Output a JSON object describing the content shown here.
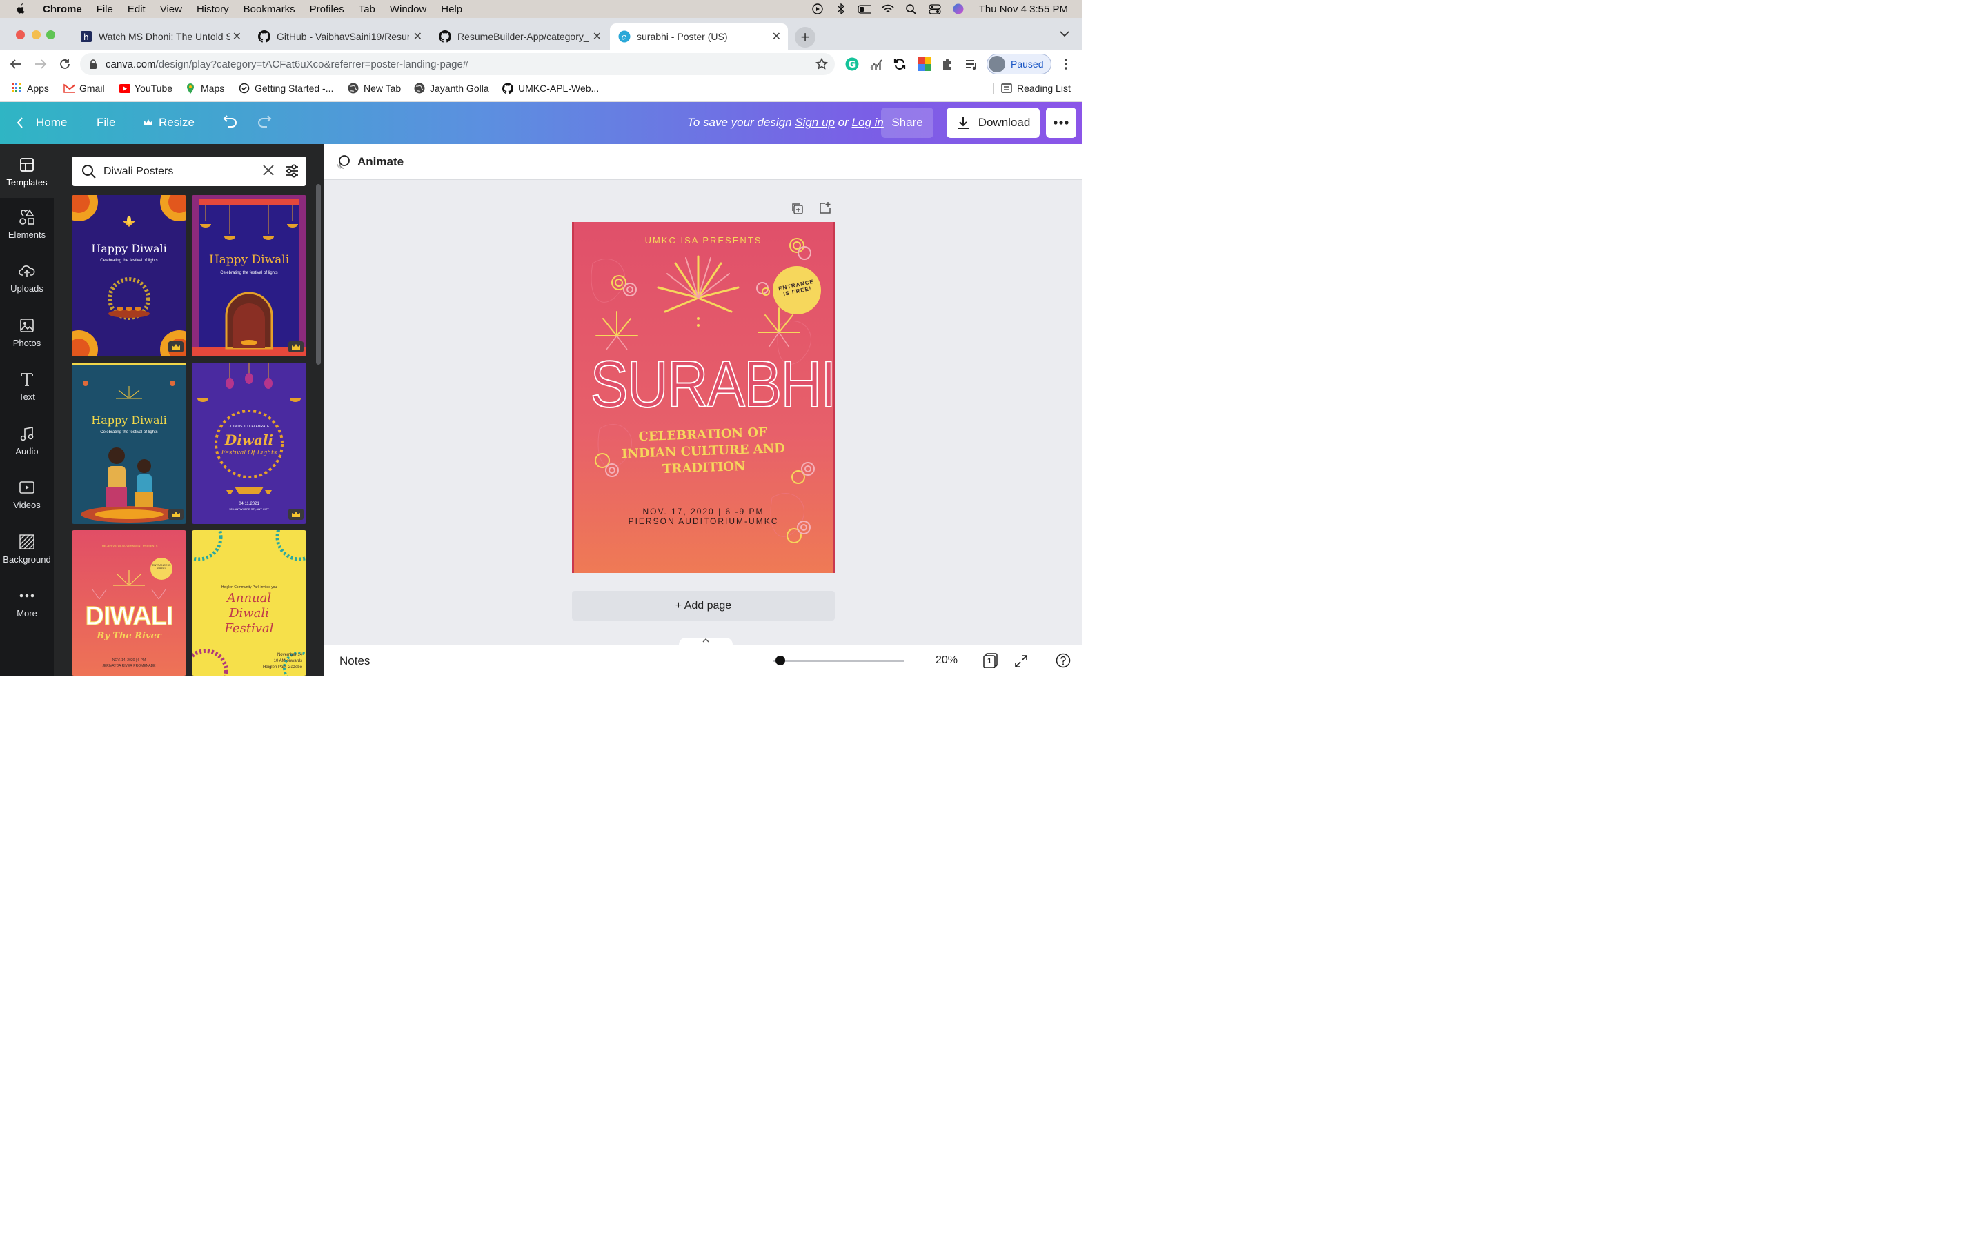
{
  "menubar": {
    "app": "Chrome",
    "items": [
      "File",
      "Edit",
      "View",
      "History",
      "Bookmarks",
      "Profiles",
      "Tab",
      "Window",
      "Help"
    ],
    "clock": "Thu Nov 4  3:55 PM"
  },
  "tabs": [
    {
      "title": "Watch MS Dhoni: The Untold S",
      "icon": "hotstar-icon"
    },
    {
      "title": "GitHub - VaibhavSaini19/Resum",
      "icon": "github-icon"
    },
    {
      "title": "ResumeBuilder-App/category_",
      "icon": "github-icon"
    },
    {
      "title": "surabhi - Poster (US)",
      "icon": "canva-icon"
    }
  ],
  "address": {
    "host": "canva.com",
    "path": "/design/play?category=tACFat6uXco&referrer=poster-landing-page#"
  },
  "profile": {
    "label": "Paused"
  },
  "bookmarks": [
    "Apps",
    "Gmail",
    "YouTube",
    "Maps",
    "Getting Started -...",
    "New Tab",
    "Jayanth Golla",
    "UMKC-APL-Web..."
  ],
  "reading_list": "Reading List",
  "canva_header": {
    "home": "Home",
    "file": "File",
    "resize": "Resize",
    "save_prefix": "To save your design",
    "sign_up": "Sign up",
    "or": "or",
    "log_in": "Log in",
    "share": "Share",
    "download": "Download"
  },
  "rail": [
    {
      "label": "Templates",
      "icon": "templates-icon"
    },
    {
      "label": "Elements",
      "icon": "elements-icon"
    },
    {
      "label": "Uploads",
      "icon": "upload-icon"
    },
    {
      "label": "Photos",
      "icon": "photo-icon"
    },
    {
      "label": "Text",
      "icon": "text-icon"
    },
    {
      "label": "Audio",
      "icon": "audio-icon"
    },
    {
      "label": "Videos",
      "icon": "video-icon"
    },
    {
      "label": "Background",
      "icon": "background-icon"
    },
    {
      "label": "More",
      "icon": "more-icon"
    }
  ],
  "search": {
    "value": "Diwali Posters"
  },
  "templates": [
    {
      "title": "Happy Diwali",
      "subtitle": "Celebrating the festival of lights"
    },
    {
      "title": "Happy Diwali",
      "subtitle": "Celebrating the festival of lights"
    },
    {
      "title": "Happy Diwali",
      "subtitle": "Celebrating the festival of lights"
    },
    {
      "title": "Diwali",
      "subtitle": "Festival Of Lights",
      "top": "JOIN US TO CELEBRATE",
      "date": "04.11.2021",
      "place": "123 ANYWHERE ST., ANY CITY"
    },
    {
      "title": "DIWALI",
      "subtitle": "By The River",
      "top": "THE JERIVAYDA GOVERNMENT PRESENTS",
      "badge": "ENTRANCE IS FREE!",
      "date": "NOV. 14, 2020 | 6 PM",
      "place": "JERIVAYDA RIVER PROMENADE"
    },
    {
      "title": "Annual Diwali Festival",
      "top": "Heiglen Community Park invites you",
      "date": "November 14",
      "time": "10 AM onwards",
      "place": "Heiglen Park Gazebo"
    }
  ],
  "editor": {
    "animate": "Animate",
    "add_page": "+ Add page",
    "notes": "Notes",
    "zoom": "20%",
    "page_count": "1"
  },
  "poster": {
    "presents": "UMKC ISA PRESENTS",
    "badge_line1": "ENTRANCE",
    "badge_line2": "IS FREE!",
    "title": "SURABHI",
    "tagline_line1": "CELEBRATION OF",
    "tagline_line2": "INDIAN CULTURE AND",
    "tagline_line3": "TRADITION",
    "date": "NOV. 17, 2020 | 6 -9 PM",
    "venue": "PIERSON AUDITORIUM-UMKC"
  },
  "colors": {
    "canva_gradient_start": "#2fb5c4",
    "canva_gradient_end": "#8b55e8",
    "poster_top": "#e0506a",
    "poster_bottom": "#ef7a55",
    "poster_yellow": "#f6d75c"
  }
}
